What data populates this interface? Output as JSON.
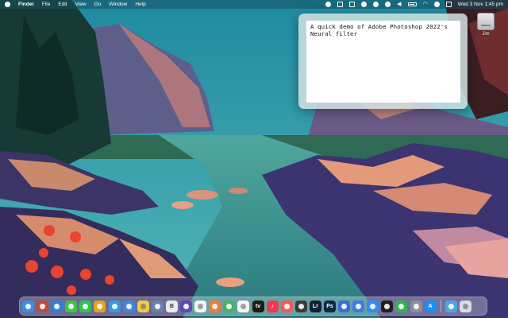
{
  "menubar": {
    "app_name": "Finder",
    "menus": [
      "File",
      "Edit",
      "View",
      "Go",
      "Window",
      "Help"
    ],
    "clock": "Wed 3 Nov  1:45 pm"
  },
  "desktop": {
    "icon_label": "Jim"
  },
  "sticky": {
    "text": "A quick demo of Adobe Photoshop 2022's\nNeural filter"
  },
  "dock": {
    "apps": [
      {
        "name": "finder-icon",
        "color": "#3a8ee6",
        "glyph": ""
      },
      {
        "name": "launchpad-icon",
        "color": "#c04a3a",
        "glyph": ""
      },
      {
        "name": "safari-icon",
        "color": "#2f7fd8",
        "glyph": ""
      },
      {
        "name": "messages-icon",
        "color": "#3ec24e",
        "glyph": ""
      },
      {
        "name": "whatsapp-icon",
        "color": "#33c25a",
        "glyph": ""
      },
      {
        "name": "superstar-icon",
        "color": "#e7a21c",
        "glyph": ""
      },
      {
        "name": "twitter-icon",
        "color": "#2f9be8",
        "glyph": ""
      },
      {
        "name": "mail-icon",
        "color": "#3d86e6",
        "glyph": ""
      },
      {
        "name": "notes-icon",
        "color": "#f2c94c",
        "glyph": ""
      },
      {
        "name": "preview-icon",
        "color": "#6a7fa8",
        "glyph": ""
      },
      {
        "name": "bbedit-icon",
        "color": "#e9e9ef",
        "glyph": "B"
      },
      {
        "name": "protonvpn-icon",
        "color": "#5b4bb7",
        "glyph": ""
      },
      {
        "name": "calendar-icon",
        "color": "#f4f4f4",
        "glyph": ""
      },
      {
        "name": "photos-icon",
        "color": "#f07a3a",
        "glyph": ""
      },
      {
        "name": "maps-icon",
        "color": "#46b36a",
        "glyph": ""
      },
      {
        "name": "reminders-icon",
        "color": "#f5f5f5",
        "glyph": ""
      },
      {
        "name": "appletv-icon",
        "color": "#1b1b1b",
        "glyph": "tv"
      },
      {
        "name": "music-icon",
        "color": "#f03a50",
        "glyph": "♪"
      },
      {
        "name": "news-icon",
        "color": "#f25a5a",
        "glyph": ""
      },
      {
        "name": "finalcut-icon",
        "color": "#3b3b3b",
        "glyph": ""
      },
      {
        "name": "lightroom-icon",
        "color": "#0e2436",
        "glyph": "Lr"
      },
      {
        "name": "photoshop-icon",
        "color": "#0b2846",
        "glyph": "Ps"
      },
      {
        "name": "pixelmator-icon",
        "color": "#3a6fd0",
        "glyph": ""
      },
      {
        "name": "xcode-icon",
        "color": "#3b7de0",
        "glyph": ""
      },
      {
        "name": "zoom-icon",
        "color": "#2d8cff",
        "glyph": ""
      },
      {
        "name": "clock-icon",
        "color": "#1e1e1e",
        "glyph": ""
      },
      {
        "name": "numbers-icon",
        "color": "#32b34e",
        "glyph": ""
      },
      {
        "name": "system-preferences-icon",
        "color": "#8a8f98",
        "glyph": ""
      },
      {
        "name": "app-store-icon",
        "color": "#1c8ef0",
        "glyph": "A"
      }
    ],
    "right_items": [
      {
        "name": "downloads-folder-icon",
        "color": "#4aa6e8",
        "glyph": ""
      },
      {
        "name": "trash-icon",
        "color": "#d8dde2",
        "glyph": ""
      }
    ]
  }
}
